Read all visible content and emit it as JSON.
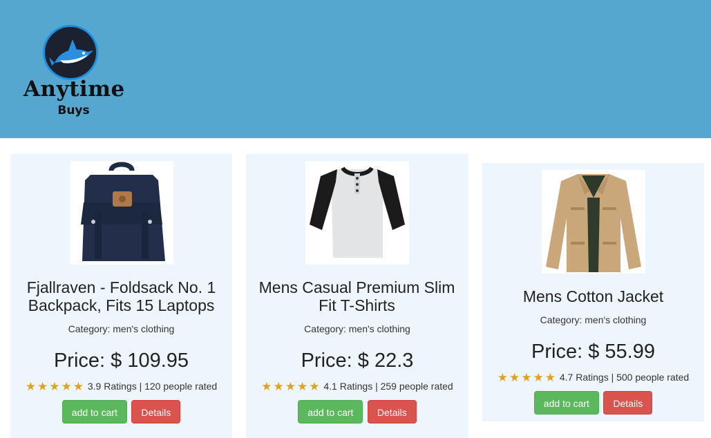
{
  "brand": {
    "name": "Anytime",
    "sub": "Buys"
  },
  "colors": {
    "header": "#56a7d0",
    "card": "#eef6fd",
    "cart": "#5cb85c",
    "details": "#d9534f",
    "star": "#e0a21c"
  },
  "products": [
    {
      "title": "Fjallraven - Foldsack No. 1 Backpack, Fits 15 Laptops",
      "category": "Category: men's clothing",
      "price": "Price: $ 109.95",
      "stars": "★★★★★",
      "rating_text": "3.9 Ratings | 120 people rated",
      "cart_label": "add to cart",
      "details_label": "Details",
      "image_icon": "backpack-image"
    },
    {
      "title": "Mens Casual Premium Slim Fit T-Shirts",
      "category": "Category: men's clothing",
      "price": "Price: $ 22.3",
      "stars": "★★★★★",
      "rating_text": "4.1 Ratings | 259 people rated",
      "cart_label": "add to cart",
      "details_label": "Details",
      "image_icon": "tshirt-image"
    },
    {
      "title": "Mens Cotton Jacket",
      "category": "Category: men's clothing",
      "price": "Price: $ 55.99",
      "stars": "★★★★★",
      "rating_text": "4.7 Ratings | 500 people rated",
      "cart_label": "add to cart",
      "details_label": "Details",
      "image_icon": "jacket-image"
    }
  ]
}
